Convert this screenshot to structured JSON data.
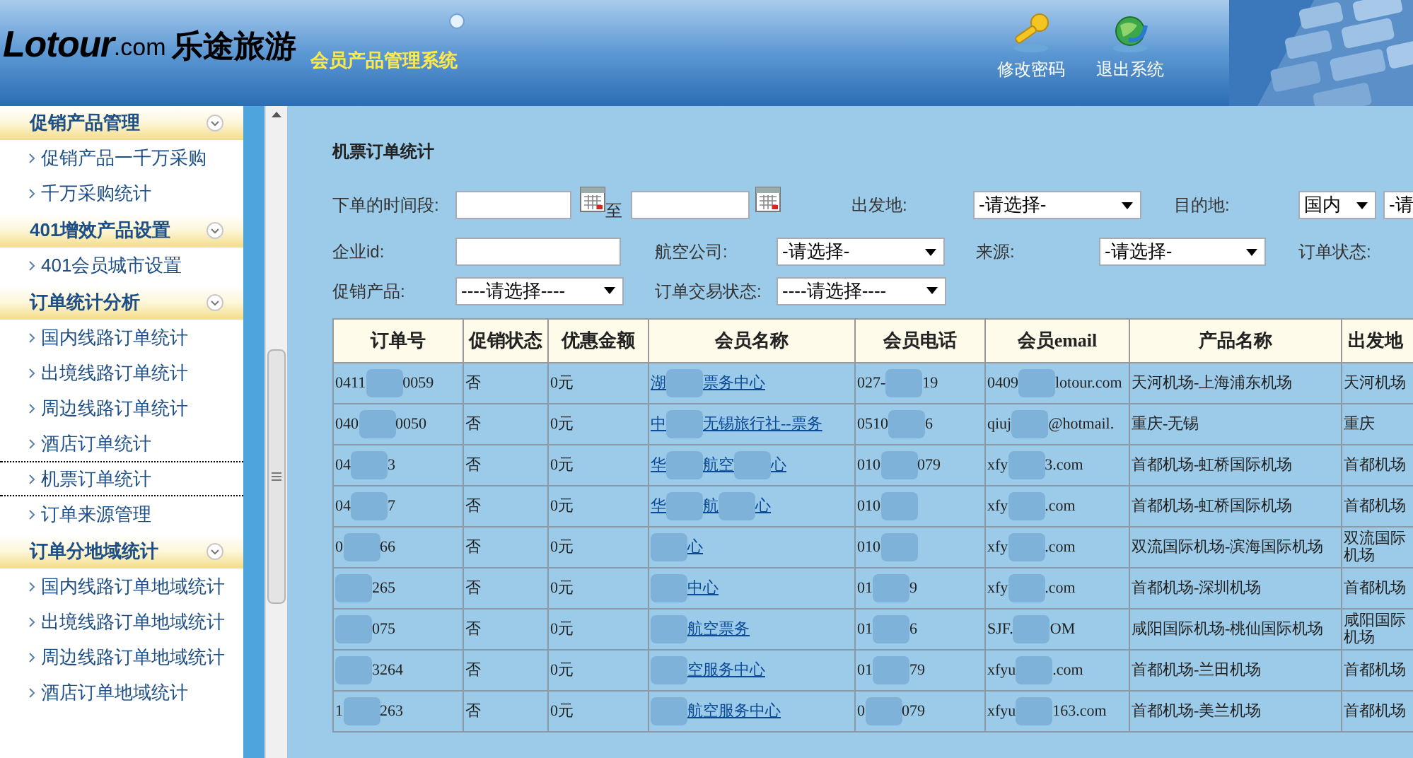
{
  "header": {
    "logo": "Lotour",
    "logo_domain": ".com",
    "brand": "乐途旅游",
    "system_title": "会员产品管理系统",
    "actions": [
      {
        "label": "修改密码",
        "kind": "key"
      },
      {
        "label": "退出系统",
        "kind": "globe"
      }
    ]
  },
  "sidebar": {
    "sections": [
      {
        "title": "促销产品管理",
        "items": [
          {
            "label": "促销产品一千万采购",
            "selected": false
          },
          {
            "label": "千万采购统计",
            "selected": false
          }
        ]
      },
      {
        "title": "401增效产品设置",
        "items": [
          {
            "label": "401会员城市设置",
            "selected": false
          }
        ]
      },
      {
        "title": "订单统计分析",
        "items": [
          {
            "label": "国内线路订单统计",
            "selected": false
          },
          {
            "label": "出境线路订单统计",
            "selected": false
          },
          {
            "label": "周边线路订单统计",
            "selected": false
          },
          {
            "label": "酒店订单统计",
            "selected": false
          },
          {
            "label": "机票订单统计",
            "selected": true
          },
          {
            "label": "订单来源管理",
            "selected": false
          }
        ]
      },
      {
        "title": "订单分地域统计",
        "items": [
          {
            "label": "国内线路订单地域统计",
            "selected": false
          },
          {
            "label": "出境线路订单地域统计",
            "selected": false
          },
          {
            "label": "周边线路订单地域统计",
            "selected": false
          },
          {
            "label": "酒店订单地域统计",
            "selected": false
          }
        ]
      }
    ]
  },
  "page_title": "机票订单统计",
  "filters": [
    [
      {
        "kind": "label",
        "text": "下单的时间段:"
      },
      {
        "kind": "date"
      },
      {
        "kind": "text",
        "text": "至"
      },
      {
        "kind": "date"
      },
      {
        "kind": "label",
        "text": "出发地:"
      },
      {
        "kind": "select",
        "value": "-请选择-"
      },
      {
        "kind": "label",
        "text": "目的地:"
      },
      {
        "kind": "select",
        "value": "国内"
      },
      {
        "kind": "select",
        "value": "-请"
      }
    ],
    [
      {
        "kind": "label",
        "text": "企业id:"
      },
      {
        "kind": "input"
      },
      {
        "kind": "label",
        "text": "航空公司:"
      },
      {
        "kind": "select",
        "value": "-请选择-"
      },
      {
        "kind": "label",
        "text": "来源:"
      },
      {
        "kind": "select",
        "value": "-请选择-"
      },
      {
        "kind": "label",
        "text": "订单状态:"
      }
    ],
    [
      {
        "kind": "label",
        "text": "促销产品:"
      },
      {
        "kind": "select",
        "value": "----请选择----"
      },
      {
        "kind": "label",
        "text": "订单交易状态:"
      },
      {
        "kind": "select",
        "value": "----请选择----"
      }
    ]
  ],
  "table": {
    "columns": [
      {
        "label": "订单号",
        "kind": "text"
      },
      {
        "label": "促销状态",
        "kind": "text"
      },
      {
        "label": "优惠金额",
        "kind": "text"
      },
      {
        "label": "会员名称",
        "kind": "link"
      },
      {
        "label": "会员电话",
        "kind": "text"
      },
      {
        "label": "会员email",
        "kind": "text"
      },
      {
        "label": "产品名称",
        "kind": "text"
      },
      {
        "label": "出发地",
        "kind": "text"
      }
    ],
    "rows": [
      [
        [
          "0411",
          {
            "kind": "redacted"
          },
          "0059"
        ],
        [
          "否"
        ],
        [
          "0元"
        ],
        [
          "湖",
          {
            "kind": "redacted"
          },
          "票务中心"
        ],
        [
          "027-",
          {
            "kind": "redacted"
          },
          "19"
        ],
        [
          "0409",
          {
            "kind": "redacted"
          },
          "lotour.com"
        ],
        [
          "天河机场-上海浦东机场"
        ],
        [
          "天河机场"
        ]
      ],
      [
        [
          "040",
          {
            "kind": "redacted"
          },
          "0050"
        ],
        [
          "否"
        ],
        [
          "0元"
        ],
        [
          "中",
          {
            "kind": "redacted"
          },
          "无锡旅行社--票务"
        ],
        [
          "0510",
          {
            "kind": "redacted"
          },
          "6"
        ],
        [
          "qiuj",
          {
            "kind": "redacted"
          },
          "@hotmail."
        ],
        [
          "重庆-无锡"
        ],
        [
          "重庆"
        ]
      ],
      [
        [
          "04",
          {
            "kind": "redacted"
          },
          "3"
        ],
        [
          "否"
        ],
        [
          "0元"
        ],
        [
          "华",
          {
            "kind": "redacted"
          },
          "航空",
          {
            "kind": "redacted"
          },
          "心"
        ],
        [
          "010",
          {
            "kind": "redacted"
          },
          "079"
        ],
        [
          "xfy",
          {
            "kind": "redacted"
          },
          "3.com"
        ],
        [
          "首都机场-虹桥国际机场"
        ],
        [
          "首都机场"
        ]
      ],
      [
        [
          "04",
          {
            "kind": "redacted"
          },
          "7"
        ],
        [
          "否"
        ],
        [
          "0元"
        ],
        [
          "华",
          {
            "kind": "redacted"
          },
          "航",
          {
            "kind": "redacted"
          },
          "心"
        ],
        [
          "010",
          {
            "kind": "redacted"
          }
        ],
        [
          "xfy",
          {
            "kind": "redacted"
          },
          ".com"
        ],
        [
          "首都机场-虹桥国际机场"
        ],
        [
          "首都机场"
        ]
      ],
      [
        [
          "0",
          {
            "kind": "redacted"
          },
          "66"
        ],
        [
          "否"
        ],
        [
          "0元"
        ],
        [
          {
            "kind": "redacted"
          },
          "心"
        ],
        [
          "010",
          {
            "kind": "redacted"
          }
        ],
        [
          "xfy",
          {
            "kind": "redacted"
          },
          ".com"
        ],
        [
          "双流国际机场-滨海国际机场"
        ],
        [
          "双流国际机场"
        ]
      ],
      [
        [
          {
            "kind": "redacted"
          },
          "265"
        ],
        [
          "否"
        ],
        [
          "0元"
        ],
        [
          {
            "kind": "redacted"
          },
          "中心"
        ],
        [
          "01",
          {
            "kind": "redacted"
          },
          "9"
        ],
        [
          "xfy",
          {
            "kind": "redacted"
          },
          ".com"
        ],
        [
          "首都机场-深圳机场"
        ],
        [
          "首都机场"
        ]
      ],
      [
        [
          {
            "kind": "redacted"
          },
          "075"
        ],
        [
          "否"
        ],
        [
          "0元"
        ],
        [
          {
            "kind": "redacted"
          },
          "航空票务"
        ],
        [
          "01",
          {
            "kind": "redacted"
          },
          "6"
        ],
        [
          "SJF.",
          {
            "kind": "redacted"
          },
          "OM"
        ],
        [
          "咸阳国际机场-桃仙国际机场"
        ],
        [
          "咸阳国际机场"
        ]
      ],
      [
        [
          {
            "kind": "redacted"
          },
          "3264"
        ],
        [
          "否"
        ],
        [
          "0元"
        ],
        [
          {
            "kind": "redacted"
          },
          "空服务中心"
        ],
        [
          "01",
          {
            "kind": "redacted"
          },
          "79"
        ],
        [
          "xfyu",
          {
            "kind": "redacted"
          },
          ".com"
        ],
        [
          "首都机场-兰田机场"
        ],
        [
          "首都机场"
        ]
      ],
      [
        [
          "1",
          {
            "kind": "redacted"
          },
          "263"
        ],
        [
          "否"
        ],
        [
          "0元"
        ],
        [
          {
            "kind": "redacted"
          },
          "航空服务中心"
        ],
        [
          "0",
          {
            "kind": "redacted"
          },
          "079"
        ],
        [
          "xfyu",
          {
            "kind": "redacted"
          },
          "163.com"
        ],
        [
          "首都机场-美兰机场"
        ],
        [
          "首都机场"
        ]
      ]
    ]
  }
}
